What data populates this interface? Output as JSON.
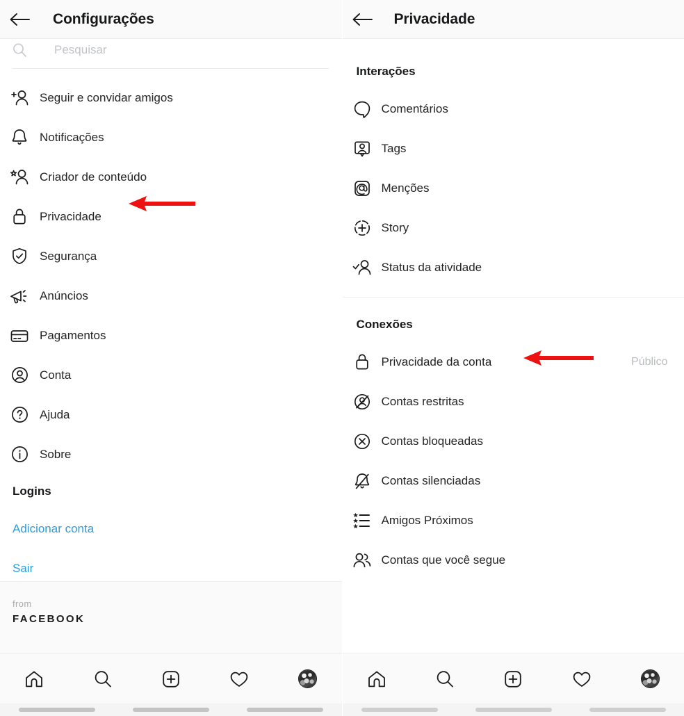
{
  "left_panel": {
    "header": {
      "title": "Configurações",
      "back_icon": "arrow-left-icon"
    },
    "search": {
      "placeholder": "Pesquisar",
      "value": "",
      "icon": "search-icon"
    },
    "items": [
      {
        "label": "Seguir e convidar amigos",
        "icon": "add-person-icon"
      },
      {
        "label": "Notificações",
        "icon": "bell-icon"
      },
      {
        "label": "Criador de conteúdo",
        "icon": "star-person-icon"
      },
      {
        "label": "Privacidade",
        "icon": "lock-icon"
      },
      {
        "label": "Segurança",
        "icon": "shield-check-icon"
      },
      {
        "label": "Anúncios",
        "icon": "megaphone-icon"
      },
      {
        "label": "Pagamentos",
        "icon": "credit-card-icon"
      },
      {
        "label": "Conta",
        "icon": "person-circle-icon"
      },
      {
        "label": "Ajuda",
        "icon": "question-circle-icon"
      },
      {
        "label": "Sobre",
        "icon": "info-circle-icon"
      }
    ],
    "logins": {
      "title": "Logins",
      "add_account": "Adicionar conta",
      "logout": "Sair"
    },
    "footer": {
      "from": "from",
      "brand": "FACEBOOK"
    }
  },
  "right_panel": {
    "header": {
      "title": "Privacidade",
      "back_icon": "arrow-left-icon"
    },
    "sections": [
      {
        "title": "Interações",
        "items": [
          {
            "label": "Comentários",
            "icon": "comment-icon",
            "value": ""
          },
          {
            "label": "Tags",
            "icon": "tag-person-icon",
            "value": ""
          },
          {
            "label": "Menções",
            "icon": "at-mention-icon",
            "value": ""
          },
          {
            "label": "Story",
            "icon": "story-plus-icon",
            "value": ""
          },
          {
            "label": "Status da atividade",
            "icon": "activity-status-icon",
            "value": ""
          }
        ]
      },
      {
        "title": "Conexões",
        "items": [
          {
            "label": "Privacidade da conta",
            "icon": "lock-icon",
            "value": "Público"
          },
          {
            "label": "Contas restritas",
            "icon": "restricted-account-icon",
            "value": ""
          },
          {
            "label": "Contas bloqueadas",
            "icon": "blocked-circle-icon",
            "value": ""
          },
          {
            "label": "Contas silenciadas",
            "icon": "bell-muted-icon",
            "value": ""
          },
          {
            "label": "Amigos Próximos",
            "icon": "close-friends-list-icon",
            "value": ""
          },
          {
            "label": "Contas que você segue",
            "icon": "people-icon",
            "value": ""
          }
        ]
      }
    ]
  },
  "bottom_nav": {
    "items": [
      {
        "icon": "home-icon"
      },
      {
        "icon": "search-icon"
      },
      {
        "icon": "add-square-icon"
      },
      {
        "icon": "heart-icon"
      },
      {
        "icon": "profile-avatar-icon"
      }
    ]
  },
  "annotations": {
    "arrow_left_panel": {
      "color": "#ee1111",
      "points_to": "Privacidade"
    },
    "arrow_right_panel": {
      "color": "#ee1111",
      "points_to": "Privacidade da conta"
    }
  }
}
